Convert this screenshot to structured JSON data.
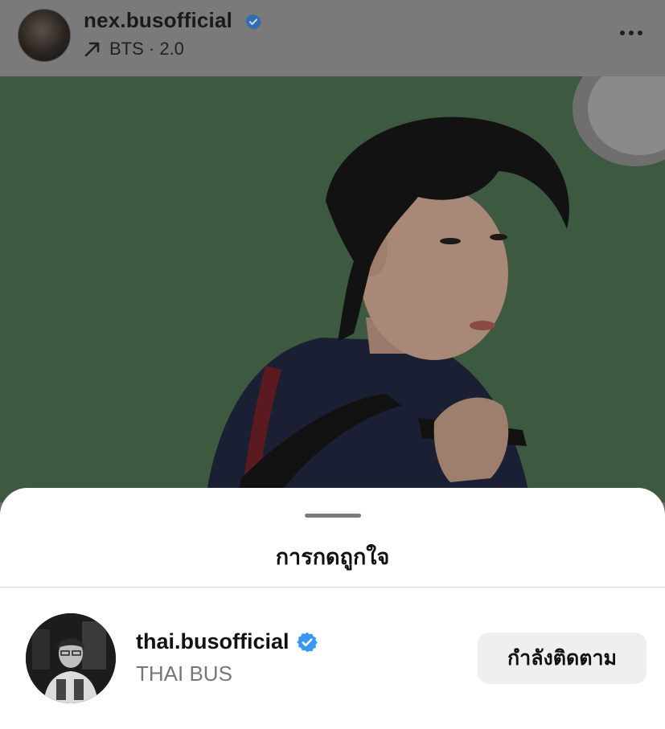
{
  "post": {
    "username": "nex.busofficial",
    "verified": true,
    "audio_label": "BTS · 2.0",
    "audio_icon": "trending-arrow-icon",
    "more_icon": "more-horizontal-icon"
  },
  "likes_sheet": {
    "title": "การกดถูกใจ",
    "likers": [
      {
        "username": "thai.busofficial",
        "verified": true,
        "full_name": "THAI BUS",
        "action_label": "กำลังติดตาม"
      }
    ]
  },
  "colors": {
    "verified_badge": "#3897f0",
    "overlay_dim": "#7a7a7a",
    "sheet_bg": "#ffffff",
    "follow_button_bg": "#efeff2"
  }
}
